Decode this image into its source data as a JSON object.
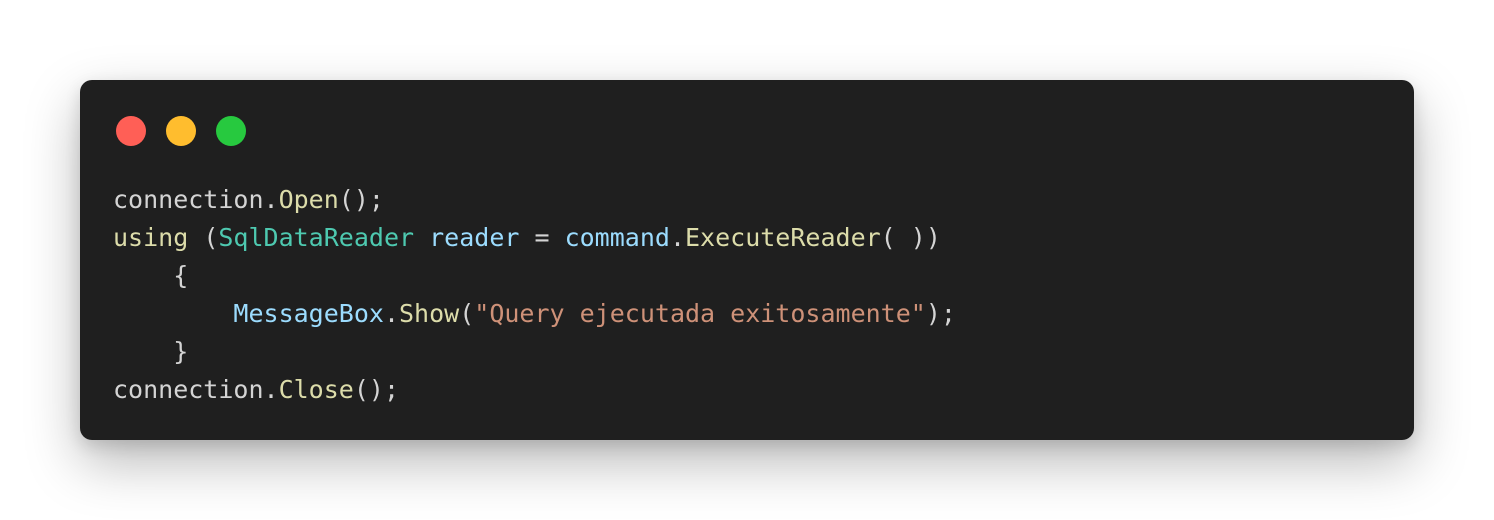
{
  "window": {
    "controls": [
      {
        "name": "close",
        "color": "#ff5f56"
      },
      {
        "name": "minimize",
        "color": "#ffbd2e"
      },
      {
        "name": "maximize",
        "color": "#27c93f"
      }
    ]
  },
  "code": {
    "language": "C#",
    "colors": {
      "background": "#1f1f1f",
      "plain": "#d4d4d4",
      "method": "#dcdcaa",
      "keyword": "#dcdcaa",
      "type": "#4ec9b0",
      "variable": "#9cdcfe",
      "string": "#ce9178"
    },
    "lines": [
      [
        {
          "text": "connection.",
          "kind": "plain"
        },
        {
          "text": "Open",
          "kind": "method"
        },
        {
          "text": "();",
          "kind": "plain"
        }
      ],
      [
        {
          "text": "using",
          "kind": "keyword"
        },
        {
          "text": " (",
          "kind": "plain"
        },
        {
          "text": "SqlDataReader",
          "kind": "type"
        },
        {
          "text": " ",
          "kind": "plain"
        },
        {
          "text": "reader",
          "kind": "var"
        },
        {
          "text": " = ",
          "kind": "plain"
        },
        {
          "text": "command",
          "kind": "var"
        },
        {
          "text": ".",
          "kind": "plain"
        },
        {
          "text": "ExecuteReader",
          "kind": "method"
        },
        {
          "text": "( ))",
          "kind": "plain"
        }
      ],
      [
        {
          "text": "    {",
          "kind": "plain"
        }
      ],
      [
        {
          "text": "        ",
          "kind": "plain"
        },
        {
          "text": "MessageBox",
          "kind": "var"
        },
        {
          "text": ".",
          "kind": "plain"
        },
        {
          "text": "Show",
          "kind": "method"
        },
        {
          "text": "(",
          "kind": "plain"
        },
        {
          "text": "\"Query ejecutada exitosamente\"",
          "kind": "string"
        },
        {
          "text": ");",
          "kind": "plain"
        }
      ],
      [
        {
          "text": "    }",
          "kind": "plain"
        }
      ],
      [
        {
          "text": "connection.",
          "kind": "plain"
        },
        {
          "text": "Close",
          "kind": "method"
        },
        {
          "text": "();",
          "kind": "plain"
        }
      ]
    ]
  }
}
